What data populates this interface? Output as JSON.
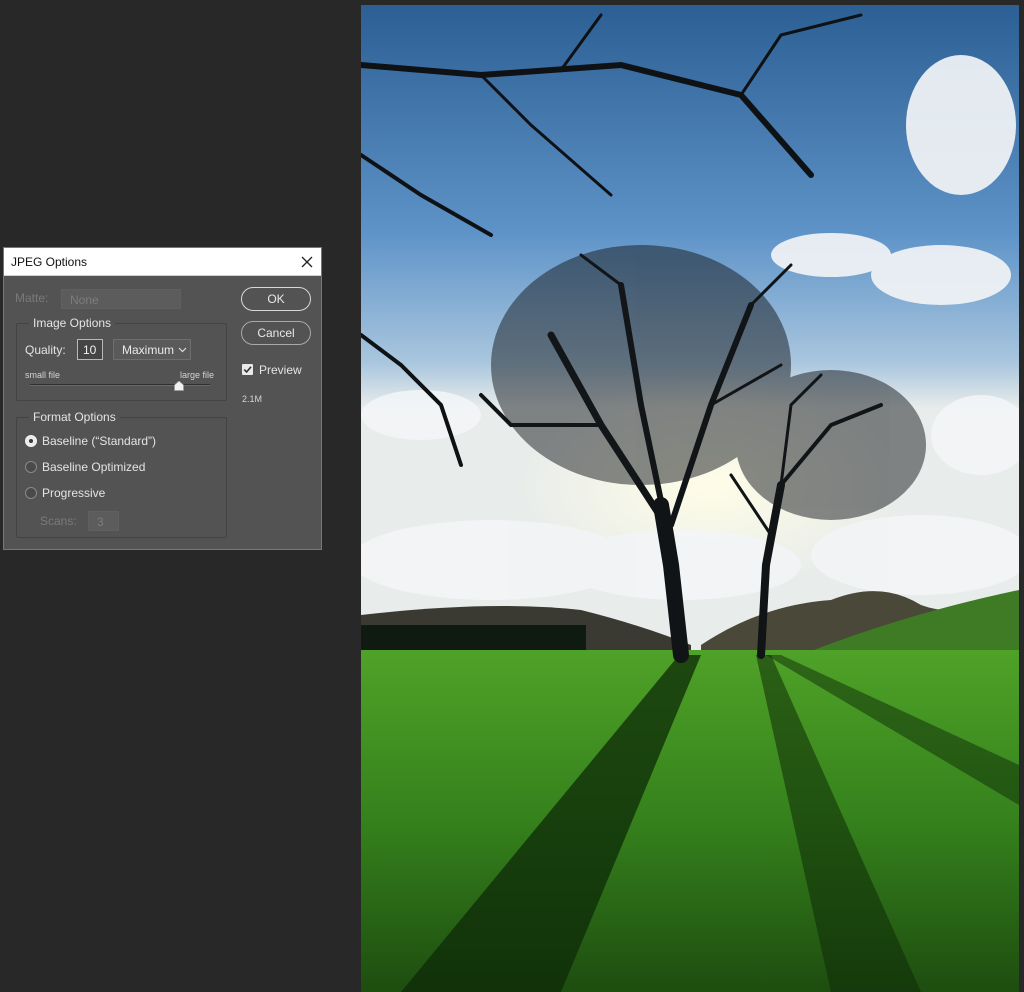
{
  "dialog": {
    "title": "JPEG Options",
    "matte": {
      "label": "Matte:",
      "value": "None"
    },
    "image_options": {
      "legend": "Image Options",
      "quality_label": "Quality:",
      "quality_value": "10",
      "quality_preset": "Maximum",
      "slider_min_label": "small file",
      "slider_max_label": "large file",
      "slider_level_fraction": 0.83
    },
    "format_options": {
      "legend": "Format Options",
      "options": [
        "Baseline (“Standard”)",
        "Baseline Optimized",
        "Progressive"
      ],
      "selected_index": 0,
      "scans_label": "Scans:",
      "scans_value": "3"
    },
    "buttons": {
      "ok": "OK",
      "cancel": "Cancel"
    },
    "preview": {
      "label": "Preview",
      "checked": true,
      "file_size": "2.1M"
    }
  },
  "icons": {
    "close": "close-icon",
    "dropdown": "chevron-down-icon",
    "slider_thumb": "slider-thumb-icon",
    "checkmark": "checkmark-icon"
  },
  "colors": {
    "workspace_bg": "#282828",
    "dialog_bg": "#535353",
    "dialog_border": "#3f86c6",
    "titlebar_bg": "#ffffff"
  }
}
